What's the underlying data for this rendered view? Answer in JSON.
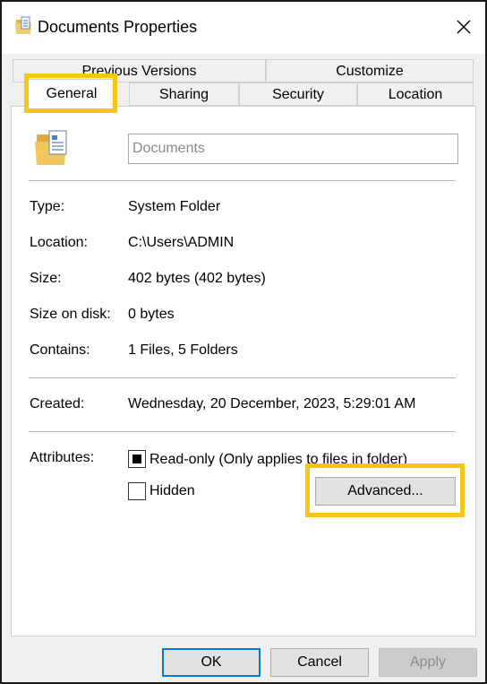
{
  "window": {
    "title": "Documents Properties",
    "close_glyph": "✕"
  },
  "tabs": [
    {
      "label": "Previous Versions",
      "active": false
    },
    {
      "label": "Customize",
      "active": false
    },
    {
      "label": "General",
      "active": true
    },
    {
      "label": "Sharing",
      "active": false
    },
    {
      "label": "Security",
      "active": false
    },
    {
      "label": "Location",
      "active": false
    }
  ],
  "general": {
    "name_value": "Documents",
    "properties": [
      {
        "label": "Type:",
        "value": "System Folder"
      },
      {
        "label": "Location:",
        "value": "C:\\Users\\ADMIN"
      },
      {
        "label": "Size:",
        "value": "402 bytes (402 bytes)"
      },
      {
        "label": "Size on disk:",
        "value": "0 bytes"
      },
      {
        "label": "Contains:",
        "value": "1 Files, 5 Folders"
      }
    ],
    "created": {
      "label": "Created:",
      "value": "Wednesday, 20 December, 2023, 5:29:01 AM"
    },
    "attributes": {
      "label": "Attributes:",
      "readonly": {
        "label": "Read-only (Only applies to files in folder)",
        "state": "indeterminate"
      },
      "hidden": {
        "label": "Hidden",
        "state": "unchecked"
      },
      "advanced_label": "Advanced..."
    }
  },
  "footer": {
    "ok": "OK",
    "cancel": "Cancel",
    "apply": "Apply"
  },
  "colors": {
    "highlight": "#f5c518",
    "default_button_border": "#0078d7",
    "folder_yellow": "#e8b64a"
  },
  "icons": {
    "title": "folder-document-icon",
    "folder": "folder-document-icon",
    "close": "close-icon"
  }
}
